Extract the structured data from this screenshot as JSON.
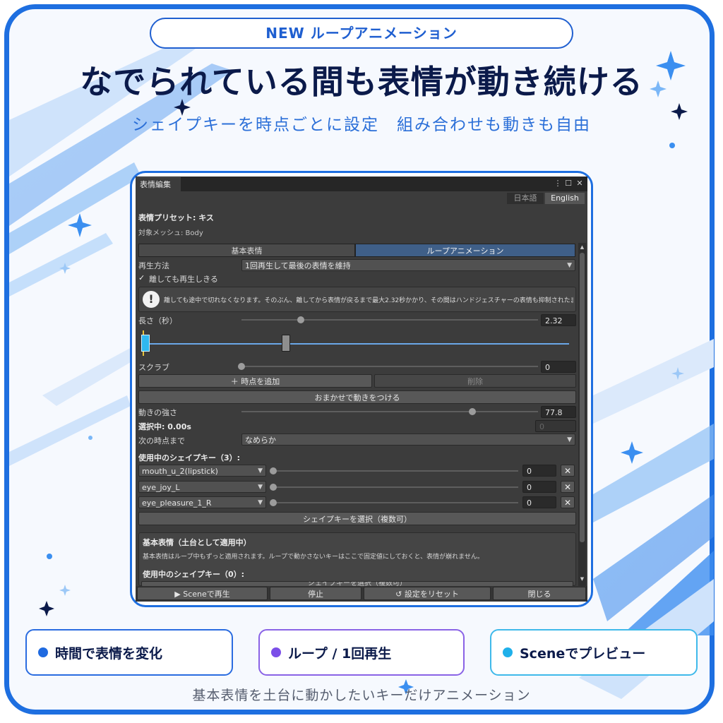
{
  "header": {
    "badge": "NEW  ループアニメーション",
    "title": "なでられている間も表情が動き続ける",
    "subtitle": "シェイプキーを時点ごとに設定　組み合わせも動きも自由"
  },
  "window": {
    "tab_label": "表情編集",
    "menu_icon": "more-vertical-icon",
    "lang_ja": "日本語",
    "lang_en": "English",
    "preset_label": "表情プリセット: キス",
    "mesh_label": "対象メッシュ: Body",
    "tabs": [
      "基本表情",
      "ループアニメーション"
    ],
    "active_tab": "ループアニメーション",
    "playback_label": "再生方法",
    "playback_value": "1回再生して最後の表情を維持",
    "checkbox_label": "離しても再生しきる",
    "checkbox_checked": true,
    "info_text": "離しても途中で切れなくなります。そのぶん、離してから表情が戻るまで最大2.32秒かかり、その間はハンドジェスチャーの表情も抑制されたままになります。",
    "length_label": "長さ（秒）",
    "length_value": "2.32",
    "length_level": 0.2,
    "timeline": {
      "keyframes": [
        0,
        0.33
      ],
      "selected": 0
    },
    "scrub_label": "スクラブ",
    "scrub_value": "0",
    "scrub_level": 0,
    "add_point_label": "＋ 時点を追加",
    "delete_label": "削除",
    "auto_motion_label": "おまかせで動きをつける",
    "strength_label": "動きの強さ",
    "strength_value": "77.8",
    "strength_level": 0.778,
    "selected_label": "選択中: 0.00s",
    "selected_field": "0",
    "next_label": "次の時点まで",
    "next_value": "なめらか",
    "shapekeys_header": "使用中のシェイプキー（3）:",
    "shapekeys": [
      {
        "name": "mouth_u_2(lipstick)",
        "value": "0"
      },
      {
        "name": "eye_joy_L",
        "value": "0"
      },
      {
        "name": "eye_pleasure_1_R",
        "value": "0"
      }
    ],
    "select_shapekeys_label": "シェイプキーを選択（複数可）",
    "base_title": "基本表情（土台として適用中）",
    "base_desc": "基本表情はループ中もずっと適用されます。ループで動かさないキーはここで固定値にしておくと、表情が崩れません。",
    "base_shapekeys_header": "使用中のシェイプキー（0）:",
    "base_select_partial": "シェイプキーを選択（複数可）",
    "bottom_buttons": [
      "▶ Sceneで再生",
      "停止",
      "↺ 設定をリセット",
      "閉じる"
    ]
  },
  "features": [
    {
      "label": "時間で表情を変化",
      "color": "#1f6ae0"
    },
    {
      "label": "ループ / 1回再生",
      "color": "#7b4ee8"
    },
    {
      "label": "Sceneでプレビュー",
      "color": "#1fb0ea"
    }
  ],
  "footer": "基本表情を土台に動かしたいキーだけアニメーション",
  "colors": {
    "accent": "#1e6fe0",
    "title": "#0b1a4a",
    "subtitle": "#2b6fd8"
  }
}
